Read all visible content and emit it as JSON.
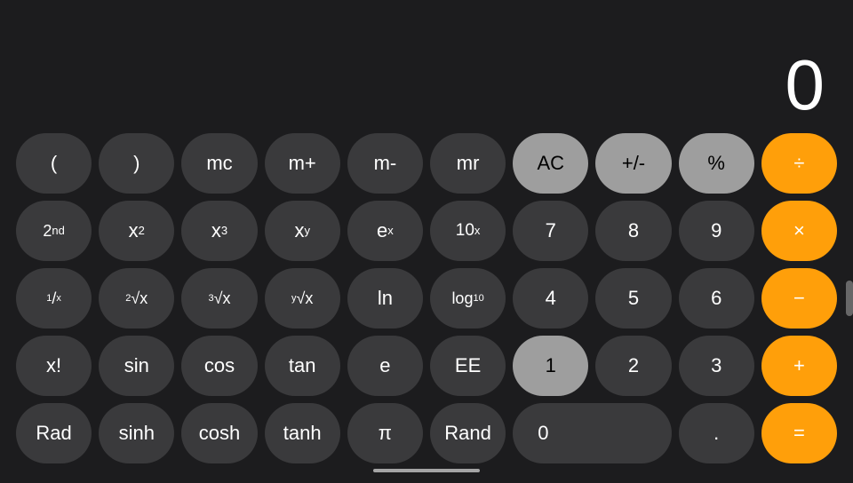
{
  "display": {
    "value": "0"
  },
  "buttons": {
    "row1": [
      {
        "id": "open-paren",
        "label": "(",
        "style": "dark"
      },
      {
        "id": "close-paren",
        "label": ")",
        "style": "dark"
      },
      {
        "id": "mc",
        "label": "mc",
        "style": "dark"
      },
      {
        "id": "m-plus",
        "label": "m+",
        "style": "dark"
      },
      {
        "id": "m-minus",
        "label": "m-",
        "style": "dark"
      },
      {
        "id": "mr",
        "label": "mr",
        "style": "dark"
      },
      {
        "id": "ac",
        "label": "AC",
        "style": "gray"
      },
      {
        "id": "plus-minus",
        "label": "+/-",
        "style": "gray"
      },
      {
        "id": "percent",
        "label": "%",
        "style": "gray"
      },
      {
        "id": "divide",
        "label": "÷",
        "style": "orange"
      }
    ],
    "row2": [
      {
        "id": "2nd",
        "label": "2nd",
        "style": "dark"
      },
      {
        "id": "x-squared",
        "label": "x²",
        "style": "dark"
      },
      {
        "id": "x-cubed",
        "label": "x³",
        "style": "dark"
      },
      {
        "id": "x-y",
        "label": "xʸ",
        "style": "dark"
      },
      {
        "id": "e-x",
        "label": "eˣ",
        "style": "dark"
      },
      {
        "id": "10-x",
        "label": "10ˣ",
        "style": "dark"
      },
      {
        "id": "7",
        "label": "7",
        "style": "dark"
      },
      {
        "id": "8",
        "label": "8",
        "style": "dark"
      },
      {
        "id": "9",
        "label": "9",
        "style": "dark"
      },
      {
        "id": "multiply",
        "label": "×",
        "style": "orange"
      }
    ],
    "row3": [
      {
        "id": "one-over-x",
        "label": "¹⁄ₓ",
        "style": "dark"
      },
      {
        "id": "sqrt2",
        "label": "²√x",
        "style": "dark"
      },
      {
        "id": "sqrt3",
        "label": "³√x",
        "style": "dark"
      },
      {
        "id": "sqrty",
        "label": "ʸ√x",
        "style": "dark"
      },
      {
        "id": "ln",
        "label": "ln",
        "style": "dark"
      },
      {
        "id": "log10",
        "label": "log₁₀",
        "style": "dark"
      },
      {
        "id": "4",
        "label": "4",
        "style": "dark"
      },
      {
        "id": "5",
        "label": "5",
        "style": "dark"
      },
      {
        "id": "6",
        "label": "6",
        "style": "dark"
      },
      {
        "id": "minus",
        "label": "−",
        "style": "orange"
      }
    ],
    "row4": [
      {
        "id": "x-factorial",
        "label": "x!",
        "style": "dark"
      },
      {
        "id": "sin",
        "label": "sin",
        "style": "dark"
      },
      {
        "id": "cos",
        "label": "cos",
        "style": "dark"
      },
      {
        "id": "tan",
        "label": "tan",
        "style": "dark"
      },
      {
        "id": "e",
        "label": "e",
        "style": "dark"
      },
      {
        "id": "ee",
        "label": "EE",
        "style": "dark"
      },
      {
        "id": "1",
        "label": "1",
        "style": "gray-dark"
      },
      {
        "id": "2",
        "label": "2",
        "style": "dark"
      },
      {
        "id": "3",
        "label": "3",
        "style": "dark"
      },
      {
        "id": "plus",
        "label": "+",
        "style": "orange"
      }
    ],
    "row5": [
      {
        "id": "rad",
        "label": "Rad",
        "style": "dark"
      },
      {
        "id": "sinh",
        "label": "sinh",
        "style": "dark"
      },
      {
        "id": "cosh",
        "label": "cosh",
        "style": "dark"
      },
      {
        "id": "tanh",
        "label": "tanh",
        "style": "dark"
      },
      {
        "id": "pi",
        "label": "π",
        "style": "dark"
      },
      {
        "id": "rand",
        "label": "Rand",
        "style": "dark"
      },
      {
        "id": "0",
        "label": "0",
        "style": "dark",
        "wide": true
      },
      {
        "id": "decimal",
        "label": ".",
        "style": "dark"
      },
      {
        "id": "equals",
        "label": "=",
        "style": "orange"
      }
    ]
  }
}
